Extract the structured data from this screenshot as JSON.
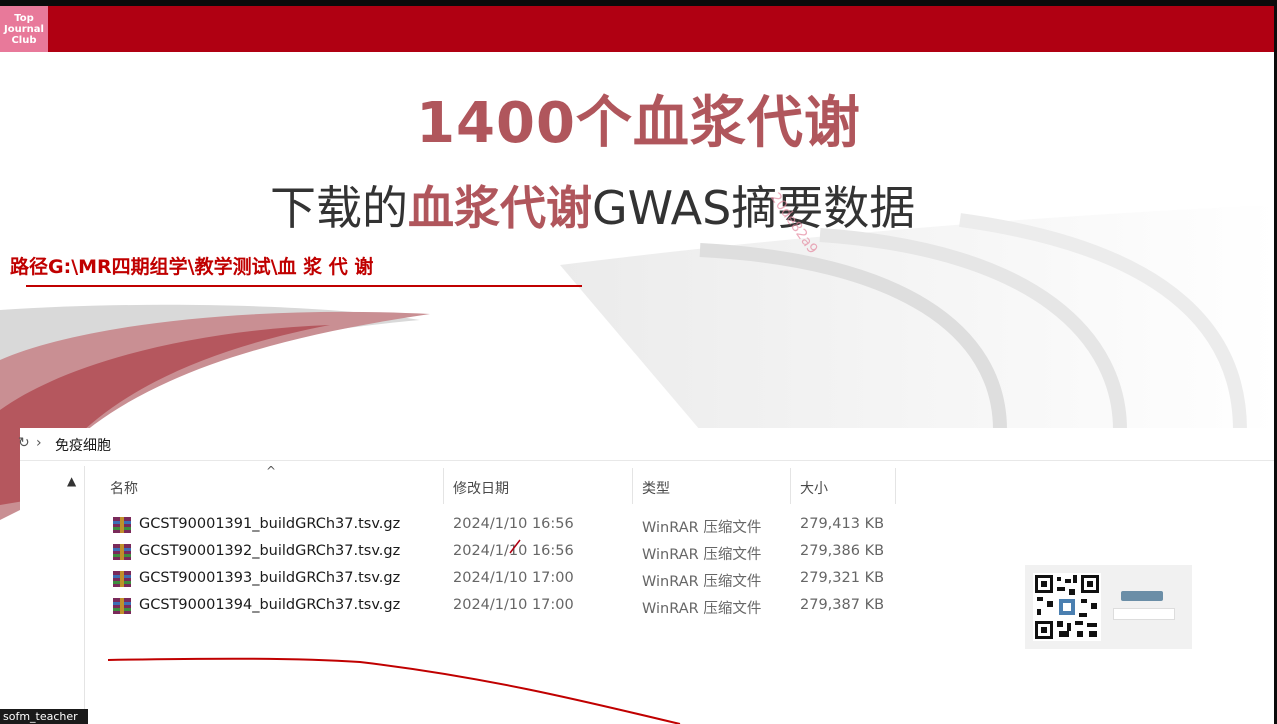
{
  "header": {
    "logo_lines": [
      "Top",
      "Journal",
      "Club"
    ]
  },
  "slide": {
    "title": "1400个血浆代谢",
    "subtitle_pre": "下载的",
    "subtitle_highlight": "血浆代谢",
    "subtitle_post": "GWAS摘要数据",
    "path_text": "路径G:\\MR四期组学\\教学测试\\血 浆 代 谢",
    "watermark": "20de82a9"
  },
  "explorer": {
    "breadcrumb": "免疫细胞",
    "columns": {
      "name": "名称",
      "date": "修改日期",
      "type": "类型",
      "size": "大小"
    },
    "files": [
      {
        "name": "GCST90001391_buildGRCh37.tsv.gz",
        "date": "2024/1/10 16:56",
        "type": "WinRAR 压缩文件",
        "size": "279,413 KB"
      },
      {
        "name": "GCST90001392_buildGRCh37.tsv.gz",
        "date": "2024/1/10 16:56",
        "type": "WinRAR 压缩文件",
        "size": "279,386 KB"
      },
      {
        "name": "GCST90001393_buildGRCh37.tsv.gz",
        "date": "2024/1/10 17:00",
        "type": "WinRAR 压缩文件",
        "size": "279,321 KB"
      },
      {
        "name": "GCST90001394_buildGRCh37.tsv.gz",
        "date": "2024/1/10 17:00",
        "type": "WinRAR 压缩文件",
        "size": "279,387 KB"
      }
    ]
  },
  "footer": {
    "user_label": "sofm_teacher"
  },
  "colors": {
    "brand_red": "#b00012",
    "title_rose": "#b0565c",
    "path_red": "#c00000"
  }
}
